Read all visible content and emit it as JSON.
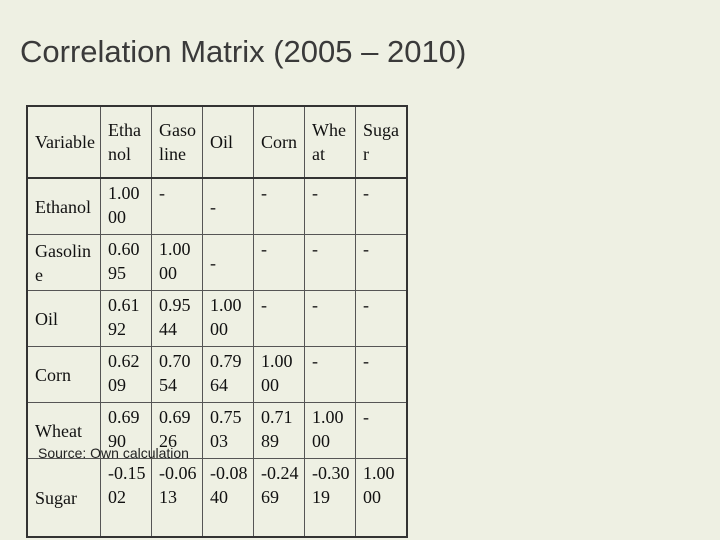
{
  "title": "Correlation Matrix (2005 – 2010)",
  "table": {
    "headers": [
      "Variable",
      "Ethanol",
      "Gasoline",
      "Oil",
      "Corn",
      "Wheat",
      "Sugar"
    ],
    "rows": [
      {
        "label": "Ethanol",
        "values": [
          "1.0000",
          "-",
          "-",
          "-",
          "-",
          "-"
        ]
      },
      {
        "label": "Gasoline",
        "values": [
          "0.6095",
          "1.0000",
          "-",
          "-",
          "-",
          "-"
        ]
      },
      {
        "label": "Oil",
        "values": [
          "0.6192",
          "0.9544",
          "1.0000",
          "-",
          "-",
          "-"
        ]
      },
      {
        "label": "Corn",
        "values": [
          "0.6209",
          "0.7054",
          "0.7964",
          "1.0000",
          "-",
          "-"
        ]
      },
      {
        "label": "Wheat",
        "values": [
          "0.6990",
          "0.6926",
          "0.7503",
          "0.7189",
          "1.0000",
          "-"
        ]
      },
      {
        "label": "Sugar",
        "values": [
          "-0.1502",
          "-0.0613",
          "-0.0840",
          "-0.2469",
          "-0.3019",
          "1.0000"
        ]
      }
    ]
  },
  "source": "Source: Own calculation"
}
